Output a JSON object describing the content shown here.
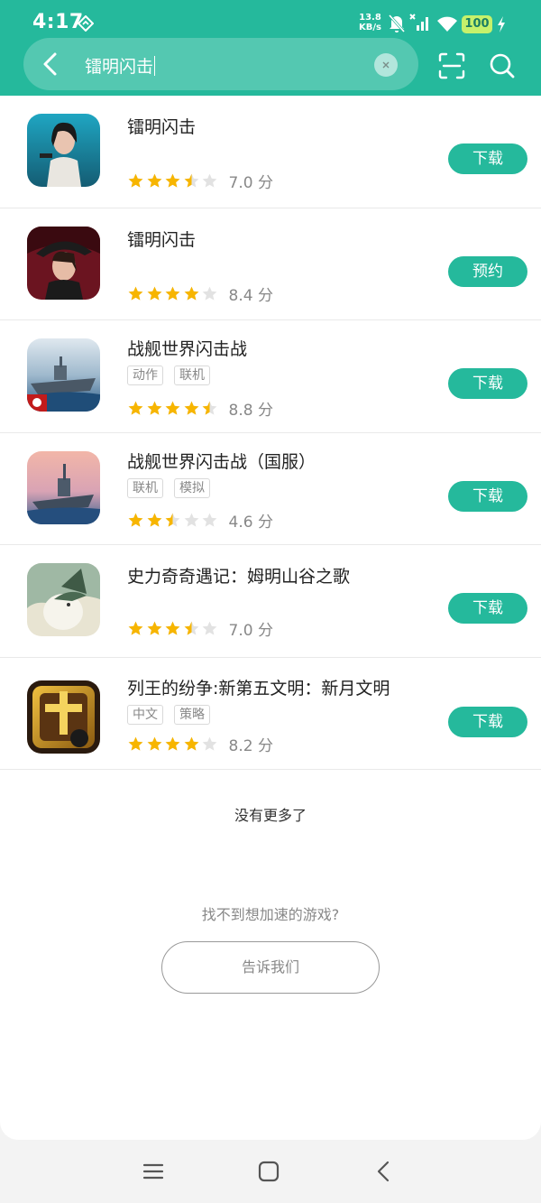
{
  "status_bar": {
    "time": "4:17",
    "net_speed_value": "13.8",
    "net_speed_unit": "KB/s",
    "battery": "100",
    "icons": [
      "navigation-diamond-icon",
      "mute-bell-icon",
      "signal-icon",
      "wifi-icon",
      "battery-icon",
      "charging-icon"
    ]
  },
  "search": {
    "query": "镭明闪击",
    "icons": [
      "back-arrow-icon",
      "clear-icon",
      "scan-icon",
      "search-icon"
    ]
  },
  "results": [
    {
      "name": "镭明闪击",
      "tags": [],
      "rating": 3.5,
      "score_text": "7.0 分",
      "action": "下载"
    },
    {
      "name": "镭明闪击",
      "tags": [],
      "rating": 4,
      "score_text": "8.4 分",
      "action": "预约"
    },
    {
      "name": "战舰世界闪击战",
      "tags": [
        "动作",
        "联机"
      ],
      "rating": 4.5,
      "score_text": "8.8 分",
      "action": "下载"
    },
    {
      "name": "战舰世界闪击战（国服）",
      "tags": [
        "联机",
        "模拟"
      ],
      "rating": 2.5,
      "score_text": "4.6 分",
      "action": "下载"
    },
    {
      "name": "史力奇奇遇记：姆明山谷之歌",
      "tags": [],
      "rating": 3.5,
      "score_text": "7.0 分",
      "action": "下载"
    },
    {
      "name": "列王的纷争:新第五文明：新月文明",
      "tags": [
        "中文",
        "策略"
      ],
      "rating": 4,
      "score_text": "8.2 分",
      "action": "下载"
    }
  ],
  "footer": {
    "no_more": "没有更多了",
    "not_found_prompt": "找不到想加速的游戏?",
    "tell_us_button": "告诉我们"
  },
  "nav_bar": {
    "icons": [
      "menu-icon",
      "home-icon",
      "back-icon"
    ]
  },
  "colors": {
    "accent": "#25b99c",
    "star_filled": "#f7b500",
    "star_empty": "#e2e2e2"
  }
}
